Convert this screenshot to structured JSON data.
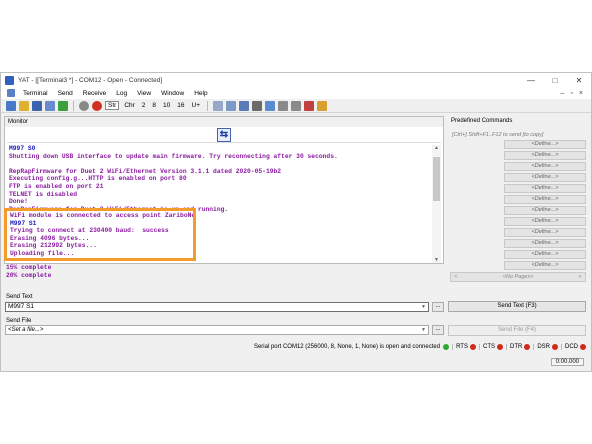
{
  "window": {
    "title": "YAT - [[Terminal3 *] - COM12 - Open - Connected]",
    "controls": [
      "—",
      "□",
      "✕"
    ]
  },
  "menu": [
    "Terminal",
    "Send",
    "Receive",
    "Log",
    "View",
    "Window",
    "Help"
  ],
  "toolbar": {
    "str": "Str",
    "chr": "Chr",
    "n2": "2",
    "n8": "8",
    "n10": "10",
    "n16": "16",
    "u": "U+"
  },
  "monitor": {
    "label": "Monitor",
    "lines": [
      {
        "text": "M997 S0",
        "kind": "sent"
      },
      {
        "text": "Shutting down USB interface to update main firmware. Try reconnecting after 30 seconds.",
        "kind": "recv"
      },
      {
        "text": "",
        "kind": "blank"
      },
      {
        "text": "RepRapFirmware for Duet 2 WiFi/Ethernet Version 3.1.1 dated 2020-05-19b2",
        "kind": "recv"
      },
      {
        "text": "Executing config.g...HTTP is enabled on port 80",
        "kind": "recv"
      },
      {
        "text": "FTP is enabled on port 21",
        "kind": "recv"
      },
      {
        "text": "TELNET is disabled",
        "kind": "recv"
      },
      {
        "text": "Done!",
        "kind": "recv"
      },
      {
        "text": "RepRapFirmware for Duet 2 WiFi/Ethernet is up and running.",
        "kind": "recv"
      }
    ]
  },
  "highlight": {
    "lines": [
      {
        "text": "WiFi module is connected to access point ZariboNet, IP address 192.1",
        "kind": "recv"
      },
      {
        "text": "M997 S1",
        "kind": "sent"
      },
      {
        "text": "Trying to connect at 230400 baud:  success",
        "kind": "recv"
      },
      {
        "text": "Erasing 4096 bytes...",
        "kind": "recv"
      },
      {
        "text": "Erasing 212992 bytes...",
        "kind": "recv"
      },
      {
        "text": "Uploading file...",
        "kind": "recv"
      },
      {
        "text": "5% complete",
        "kind": "recv"
      }
    ]
  },
  "below_highlight": [
    "15% complete",
    "20% complete"
  ],
  "predefined": {
    "label": "Predefined Commands",
    "hint": "[Ctrl+] Shift+F1..F12 to send [to copy]",
    "define_label": "<Define...>",
    "count": 12,
    "pager": "<No Pages>"
  },
  "send_text": {
    "label": "Send Text",
    "value": "M997 S1",
    "button": "Send Text (F3)"
  },
  "send_file": {
    "label": "Send File",
    "value": "<Set a file...>",
    "button": "Send File (F4)"
  },
  "status": {
    "text": "Serial port COM12 (256000, 8, None, 1, None) is open and connected",
    "signals": [
      "RTS",
      "CTS",
      "DTR",
      "DSR",
      "DCD"
    ],
    "timer": "0:00.000"
  },
  "colors": {
    "received": "#8a1aa0",
    "sent": "#1a1ab8",
    "highlight_border": "#f39b2b"
  }
}
